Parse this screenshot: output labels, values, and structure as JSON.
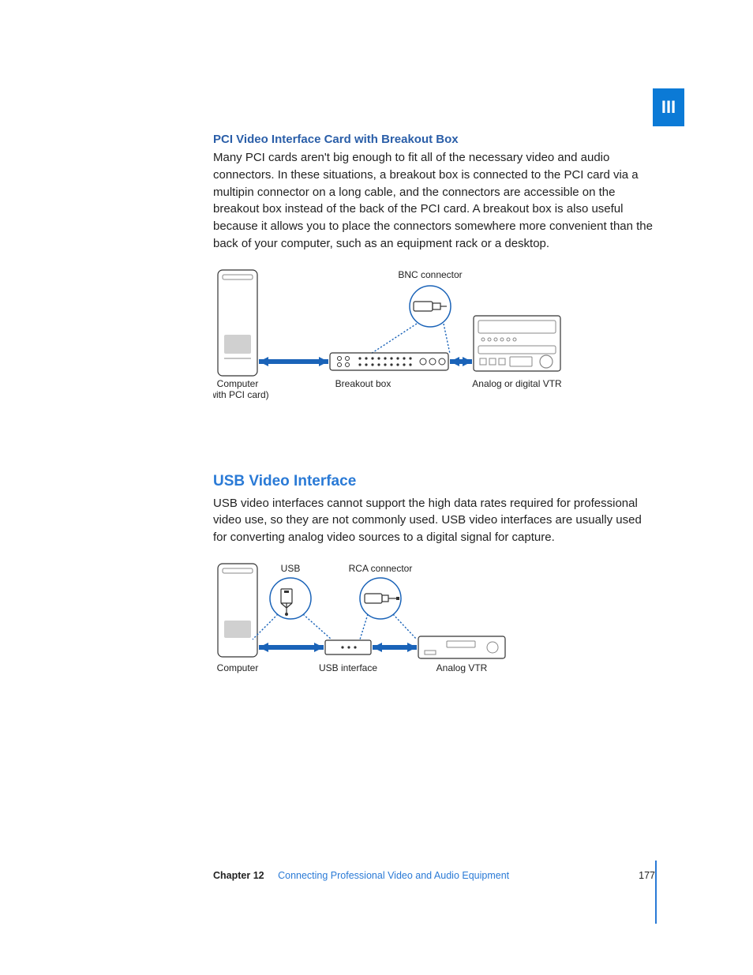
{
  "sideTab": "III",
  "section1": {
    "heading": "PCI Video Interface Card with Breakout Box",
    "body": "Many PCI cards aren't big enough to fit all of the necessary video and audio connectors. In these situations, a breakout box is connected to the PCI card via a multipin connector on a long cable, and the connectors are accessible on the breakout box instead of the back of the PCI card. A breakout box is also useful because it allows you to place the connectors somewhere more convenient than the back of your computer, such as an equipment rack or a desktop."
  },
  "diagram1": {
    "connector": "BNC connector",
    "computer": "Computer",
    "computerSub": "(with PCI card)",
    "breakout": "Breakout box",
    "vtr": "Analog or digital VTR"
  },
  "section2": {
    "heading": "USB Video Interface",
    "body": "USB video interfaces cannot support the high data rates required for professional video use, so they are not commonly used. USB video interfaces are usually used for converting analog video sources to a digital signal for capture."
  },
  "diagram2": {
    "usb": "USB",
    "rca": "RCA connector",
    "computer": "Computer",
    "usbIf": "USB interface",
    "vtr": "Analog VTR"
  },
  "footer": {
    "chapter": "Chapter 12",
    "title": "Connecting Professional Video and Audio Equipment",
    "page": "177"
  }
}
